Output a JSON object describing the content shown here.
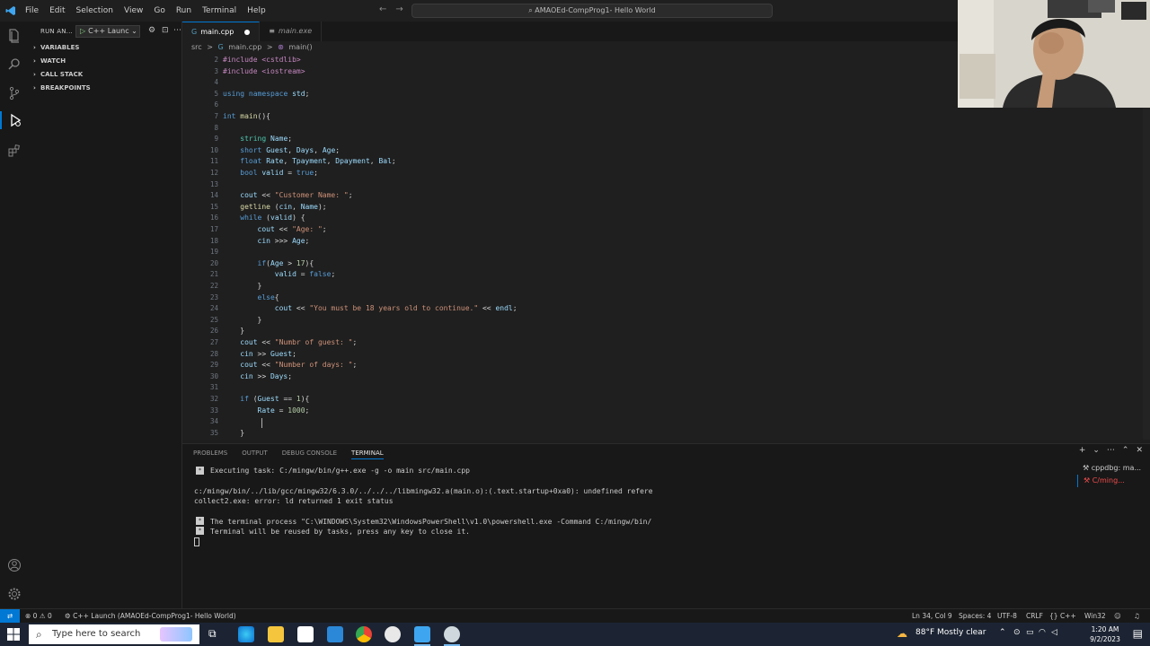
{
  "titlebar": {
    "menu": [
      "File",
      "Edit",
      "Selection",
      "View",
      "Go",
      "Run",
      "Terminal",
      "Help"
    ],
    "command_center": "AMAOEd-CompProg1- Hello World"
  },
  "sidebar": {
    "title": "RUN AN...",
    "launch_config": "C++ Launc",
    "sections": [
      "VARIABLES",
      "WATCH",
      "CALL STACK",
      "BREAKPOINTS"
    ]
  },
  "tabs": [
    {
      "label": "main.cpp",
      "modified": true,
      "active": true
    },
    {
      "label": "main.exe",
      "modified": false,
      "active": false
    }
  ],
  "breadcrumb": [
    "src",
    ">",
    "main.cpp",
    ">",
    "main()"
  ],
  "editor": {
    "lines": [
      {
        "n": "2",
        "text": "#include <cstdlib>"
      },
      {
        "n": "3",
        "text": "#include <iostream>"
      },
      {
        "n": "4",
        "text": ""
      },
      {
        "n": "5",
        "text": "using namespace std;"
      },
      {
        "n": "6",
        "text": ""
      },
      {
        "n": "7",
        "text": "int main(){"
      },
      {
        "n": "8",
        "text": ""
      },
      {
        "n": "9",
        "text": "    string Name;"
      },
      {
        "n": "10",
        "text": "    short Guest, Days, Age;"
      },
      {
        "n": "11",
        "text": "    float Rate, Tpayment, Dpayment, Bal;"
      },
      {
        "n": "12",
        "text": "    bool valid = true;"
      },
      {
        "n": "13",
        "text": ""
      },
      {
        "n": "14",
        "text": "    cout << \"Customer Name: \";"
      },
      {
        "n": "15",
        "text": "    getline (cin, Name);"
      },
      {
        "n": "16",
        "text": "    while (valid) {"
      },
      {
        "n": "17",
        "text": "        cout << \"Age: \";"
      },
      {
        "n": "18",
        "text": "        cin >>> Age;"
      },
      {
        "n": "19",
        "text": ""
      },
      {
        "n": "20",
        "text": "        if(Age > 17){"
      },
      {
        "n": "21",
        "text": "            valid = false;"
      },
      {
        "n": "22",
        "text": "        }"
      },
      {
        "n": "23",
        "text": "        else{"
      },
      {
        "n": "24",
        "text": "            cout << \"You must be 18 years old to continue.\" << endl;"
      },
      {
        "n": "25",
        "text": "        }"
      },
      {
        "n": "26",
        "text": "    }"
      },
      {
        "n": "27",
        "text": "    cout << \"Numbr of guest: \";"
      },
      {
        "n": "28",
        "text": "    cin >> Guest;"
      },
      {
        "n": "29",
        "text": "    cout << \"Number of days: \";"
      },
      {
        "n": "30",
        "text": "    cin >> Days;"
      },
      {
        "n": "31",
        "text": ""
      },
      {
        "n": "32",
        "text": "    if (Guest == 1){"
      },
      {
        "n": "33",
        "text": "        Rate = 1000;"
      },
      {
        "n": "34",
        "text": ""
      },
      {
        "n": "35",
        "text": "    }"
      }
    ]
  },
  "panel": {
    "tabs": [
      "PROBLEMS",
      "OUTPUT",
      "DEBUG CONSOLE",
      "TERMINAL"
    ],
    "active_tab": "TERMINAL",
    "terminal_lines": [
      "Executing task: C:/mingw/bin/g++.exe -g -o main src/main.cpp",
      "c:/mingw/bin/../lib/gcc/mingw32/6.3.0/../../../libmingw32.a(main.o):(.text.startup+0xa0): undefined refere",
      "collect2.exe: error: ld returned 1 exit status",
      "The terminal process \"C:\\WINDOWS\\System32\\WindowsPowerShell\\v1.0\\powershell.exe -Command C:/mingw/bin/",
      "Terminal will be reused by tasks, press any key to close it."
    ],
    "terminals": [
      "cppdbg: ma...",
      "C/ming..."
    ]
  },
  "statusbar": {
    "problems": "0",
    "warnings": "0",
    "launch": "C++ Launch (AMAOEd-CompProg1- Hello World)",
    "position": "Ln 34, Col 9",
    "spaces": "Spaces: 4",
    "encoding": "UTF-8",
    "eol": "CRLF",
    "language": "C++",
    "platform": "Win32"
  },
  "taskbar": {
    "search_placeholder": "Type here to search",
    "weather_temp": "88°F",
    "weather_text": "Mostly clear",
    "time": "1:20 AM",
    "date": "9/2/2023"
  },
  "colors": {
    "accent": "#0078d4",
    "editor_bg": "#1f1f1f",
    "keyword": "#569cd6",
    "string": "#ce9178"
  }
}
